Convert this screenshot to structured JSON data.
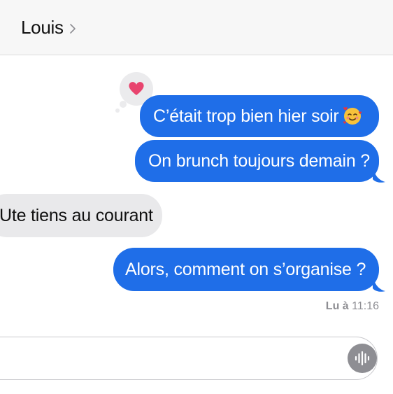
{
  "header": {
    "contact_name": "Louis",
    "chevron_icon": "chevron-right-icon"
  },
  "messages": [
    {
      "direction": "sent",
      "text": "C’était trop bien hier soir",
      "emoji": "smiling-face-with-hearts",
      "reaction": "heart"
    },
    {
      "direction": "sent",
      "text": "On brunch toujours demain ?"
    },
    {
      "direction": "received",
      "text": "Ute tiens au courant"
    },
    {
      "direction": "sent",
      "text": "Alors, comment on s’organise ?"
    }
  ],
  "read_receipt": {
    "label": "Lu à",
    "time": "11:16"
  },
  "composer": {
    "placeholder": "",
    "audio_icon": "audio-waveform-icon"
  },
  "colors": {
    "sent_bubble": "#1f6ee8",
    "received_bubble": "#e9e9eb",
    "heart": "#e8446e",
    "header_bg": "#f7f7f7",
    "audio_button": "#8e8e93"
  }
}
